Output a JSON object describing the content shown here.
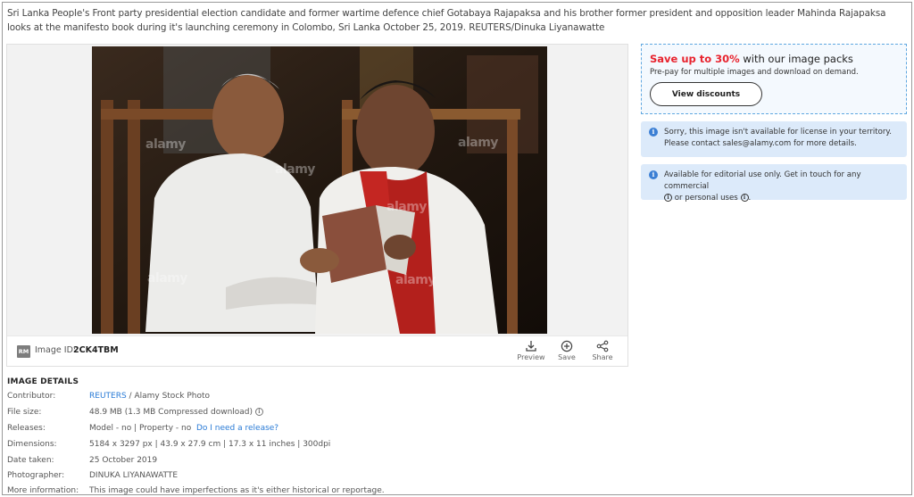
{
  "caption": "Sri Lanka People's Front party presidential election candidate and former wartime defence chief Gotabaya Rajapaksa and his brother former president and opposition leader Mahinda Rajapaksa looks at the manifesto book during it's launching ceremony in Colombo, Sri Lanka October 25, 2019. REUTERS/Dinuka Liyanawatte",
  "image_panel": {
    "badge": "RM",
    "id_label": "Image ID:",
    "id_value": "2CK4TBM",
    "watermark": "alamy",
    "actions": [
      {
        "label": "Preview",
        "icon": "download-icon"
      },
      {
        "label": "Save",
        "icon": "plus-circle-icon"
      },
      {
        "label": "Share",
        "icon": "share-icon"
      }
    ]
  },
  "promo": {
    "highlight": "Save up to 30%",
    "title_rest": " with our image packs",
    "subtitle": "Pre-pay for multiple images and download on demand.",
    "button": "View discounts"
  },
  "notes": [
    {
      "text": "Sorry, this image isn't available for license in your territory. Please contact sales@alamy.com for more details."
    },
    {
      "text_a": "Available for editorial use only. Get in touch for any commercial",
      "text_b": "or personal uses",
      "text_c": "."
    }
  ],
  "details": {
    "title": "IMAGE DETAILS",
    "contributor_label": "Contributor:",
    "contributor_link": "REUTERS",
    "contributor_rest": " / Alamy Stock Photo",
    "filesize_label": "File size:",
    "filesize_value": "48.9 MB (1.3 MB Compressed download)",
    "releases_label": "Releases:",
    "releases_value": "Model - no | Property - no",
    "releases_link": "Do I need a release?",
    "dimensions_label": "Dimensions:",
    "dimensions_value": "5184 x 3297 px | 43.9 x 27.9 cm | 17.3 x 11 inches | 300dpi",
    "date_label": "Date taken:",
    "date_value": "25 October 2019",
    "photographer_label": "Photographer:",
    "photographer_link": "DINUKA LIYANAWATTE",
    "more_label": "More information:",
    "more_value": "This image could have imperfections as it's either historical or reportage."
  },
  "colors": {
    "accent": "#2a7bd6",
    "promo_red": "#e8232e",
    "note_bg": "#dceafa"
  }
}
